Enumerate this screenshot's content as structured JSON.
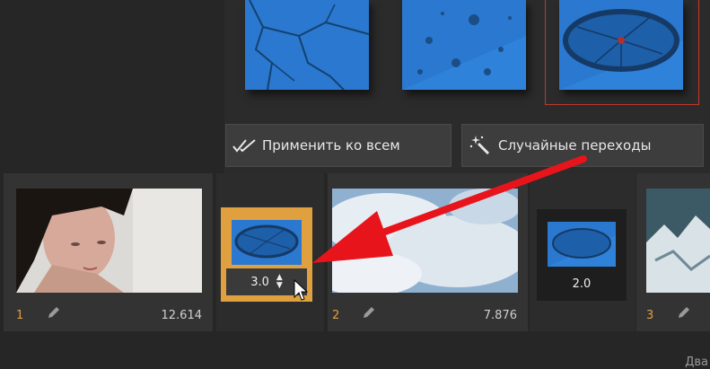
{
  "toolbar": {
    "apply_all_label": "Применить ко всем",
    "apply_all_icon": "double-check-icon",
    "random_label": "Случайные переходы",
    "random_icon": "magic-wand-icon"
  },
  "timeline": {
    "clips": [
      {
        "number": "1",
        "duration": "12.614"
      },
      {
        "number": "2",
        "duration": "7.876"
      },
      {
        "number": "3",
        "duration": ""
      }
    ],
    "transitions": [
      {
        "duration": "3.0"
      },
      {
        "duration": "2.0"
      }
    ]
  },
  "status_text": "Два",
  "colors": {
    "accent_orange": "#e0a040",
    "arrow_red": "#e8141c",
    "thumb_blue": "#1f6fc4"
  }
}
